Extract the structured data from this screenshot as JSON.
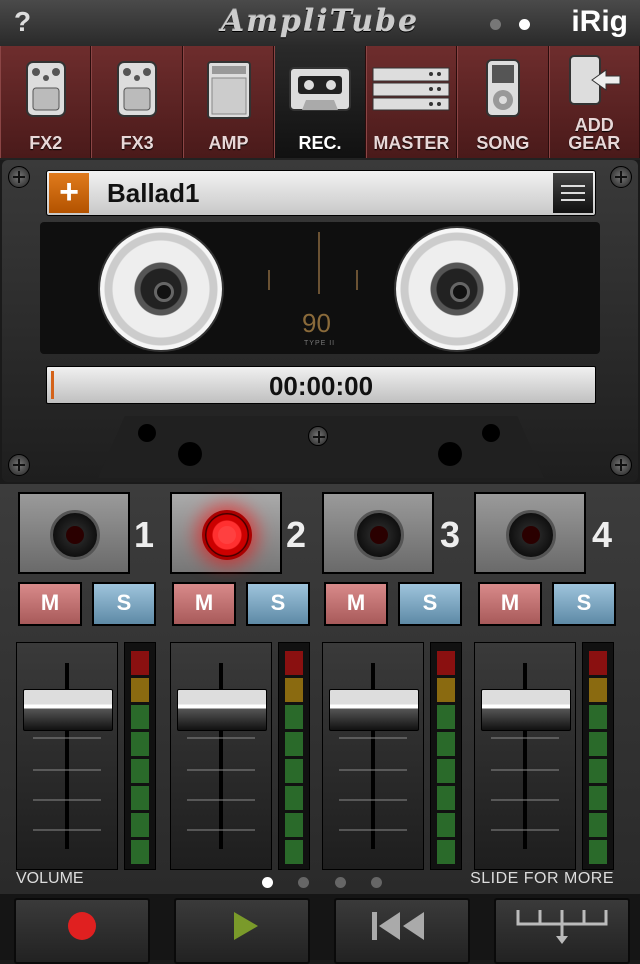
{
  "topbar": {
    "help": "?",
    "logo": "AmpliTube",
    "brand": "iRig",
    "pages": [
      "off",
      "on"
    ]
  },
  "nav": {
    "tabs": [
      {
        "label": "FX2",
        "icon": "stompbox-icon",
        "active": false
      },
      {
        "label": "FX3",
        "icon": "stompbox-icon",
        "active": false
      },
      {
        "label": "AMP",
        "icon": "amp-icon",
        "active": false
      },
      {
        "label": "REC.",
        "icon": "cassette-icon",
        "active": true
      },
      {
        "label": "MASTER",
        "icon": "rack-icon",
        "active": false
      },
      {
        "label": "SONG",
        "icon": "ipod-icon",
        "active": false
      },
      {
        "label": "ADD GEAR",
        "icon": "add-gear-icon",
        "active": false
      }
    ]
  },
  "deck": {
    "song_name": "Ballad1",
    "add_symbol": "+",
    "tape_label": "90",
    "tape_type": "TYPE II",
    "time": "00:00:00"
  },
  "mixer": {
    "tracks": [
      {
        "number": "1",
        "armed": false,
        "mute": "M",
        "solo": "S"
      },
      {
        "number": "2",
        "armed": true,
        "mute": "M",
        "solo": "S"
      },
      {
        "number": "3",
        "armed": false,
        "mute": "M",
        "solo": "S"
      },
      {
        "number": "4",
        "armed": false,
        "mute": "M",
        "solo": "S"
      }
    ],
    "volume_label": "VOLUME",
    "slide_label": "SLIDE FOR MORE",
    "pages": [
      "on",
      "off",
      "off",
      "off"
    ]
  },
  "transport": {
    "buttons": [
      "record-icon",
      "play-icon",
      "rewind-icon",
      "bounce-icon"
    ]
  },
  "colors": {
    "nav": "#5a2222",
    "record": "#e02020",
    "play": "#7a9a2a",
    "add": "#c8660a",
    "mute": "#c07070",
    "solo": "#7aa6c2"
  }
}
